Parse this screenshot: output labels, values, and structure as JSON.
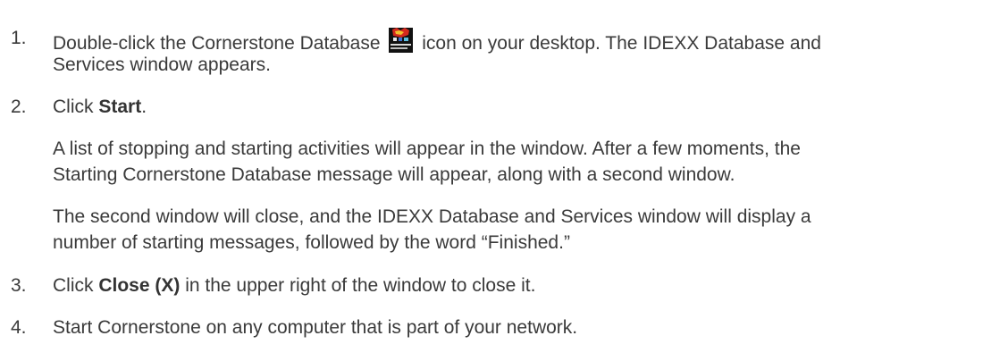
{
  "steps": [
    {
      "number": "1.",
      "text_before_icon": "Double-click the Cornerstone Database",
      "icon": "cornerstone-database-icon",
      "text_after_icon": "icon on your desktop. The IDEXX Database and",
      "continuation": "Services window appears."
    },
    {
      "number": "2.",
      "prefix": "Click ",
      "bold": "Start",
      "suffix": ".",
      "paragraph_1_line_1": "A list of stopping and starting activities will appear in the window. After a few moments, the",
      "paragraph_1_line_2": "Starting Cornerstone Database message will appear, along with a second window.",
      "paragraph_2_line_1": "The second window will close, and the IDEXX Database and Services window will display a",
      "paragraph_2_line_2": "number of starting messages, followed by the word “Finished.”"
    },
    {
      "number": "3.",
      "prefix": "Click ",
      "bold": "Close (X)",
      "suffix": " in the upper right of the window to close it."
    },
    {
      "number": "4.",
      "text": "Start Cornerstone on any computer that is part of your network."
    }
  ]
}
